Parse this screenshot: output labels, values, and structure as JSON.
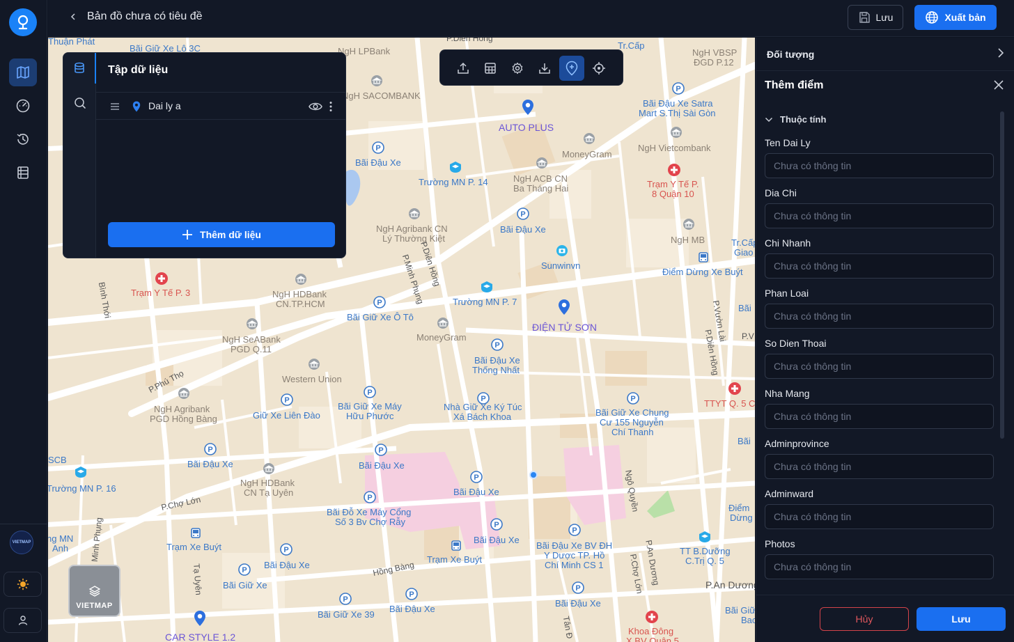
{
  "header": {
    "title": "Bản đồ chưa có tiêu đề",
    "save_label": "Lưu",
    "export_label": "Xuất bản"
  },
  "rail": {
    "brand": "VIETMAP"
  },
  "dataset": {
    "title": "Tập dữ liệu",
    "layers": [
      {
        "name": "Dai ly a"
      }
    ],
    "add_label": "Thêm dữ liệu"
  },
  "layer_switcher": {
    "label": "VIETMAP"
  },
  "map_labels": {
    "autoplus": "AUTO PLUS",
    "dientuson": "ĐIỆN TỬ SƠN",
    "carstyle": "CAR STYLE 1.2",
    "truong14": "Trường MN P. 14",
    "truong7": "Trường MN P. 7",
    "truong16": "Trường MN P. 16",
    "baidauxe": "Bãi Đậu Xe",
    "baigiuxeoto": "Bãi Giữ Xe Ô Tô",
    "moneygram": "MoneyGram",
    "westernunion": "Western Union",
    "ngh_sacombank": "NgH SACOMBANK",
    "ngh_lpbank": "NgH LPBank",
    "ngh_acb": "NgH ACB CN",
    "ngh_acb2": "Ba Tháng Hai",
    "ngh_agribank": "NgH Agribank CN",
    "ngh_agribank2": "Lý Thường Kiệt",
    "ngh_vietcombank": "NgH Vietcombank",
    "ngh_vbsp": "NgH VBSP",
    "ngh_vbsp2": "ĐGD P.12",
    "ngh_mb": "NgH MB",
    "ngh_hdbank": "NgH HDBank",
    "ngh_hdbank2": "CN.TP.HCM",
    "ngh_seabank": "NgH SeABank",
    "ngh_seabank2": "PGD Q.11",
    "ngh_agri_hb": "NgH Agribank",
    "ngh_agri_hb2": "PGD Hồng Bàng",
    "ngh_hd_tu": "NgH HDBank",
    "ngh_hd_tu2": "CN Tạ Uyên",
    "sunwinvn": "Sunwinvn",
    "tramyte8": "Trạm Y Tế P.",
    "tramyte8b": "8 Quận 10",
    "tramyte3": "Trạm Y Tế P. 3",
    "ttyt5": "TTYT Q. 5 C",
    "khoadong": "Khoa Đông",
    "diemdung": "Điểm Dừng Xe Buýt",
    "trambuyt": "Trạm Xe Buýt",
    "satra": "Bãi Đậu Xe Satra",
    "satra2": "Mart S.Thị Sài Gòn",
    "thongnhat": "Bãi Đậu Xe",
    "thongnhat2": "Thống Nhất",
    "kytuc": "Nhà Giữ Xe Ký Túc",
    "kytuc2": "Xá Bách Khoa",
    "chungcu": "Bãi Giữ Xe Chung",
    "chungcu2": "Cư 155 Nguyễn",
    "chungcu3": "Chí Thanh",
    "huuphuoc": "Bãi Giữ Xe Máy",
    "huuphuoc2": "Hữu Phước",
    "liendao": "Giữ Xe Liên Đào",
    "chorayb": "Bãi Đỗ Xe Máy Cổng",
    "chorayb2": "Số 3 Bv Chợ Rẫy",
    "bvdh": "Bãi Đậu Xe BV ĐH",
    "bvdh2": "Y Dược TP. Hồ",
    "bvdh3": "Chí Minh CS 1",
    "giuxe": "Bãi Giữ Xe",
    "giuxe39": "Bãi Giữ Xe 39",
    "ttbduong": "TT B.Dưỡng",
    "ttbduong2": "C.Trị Q. 5",
    "lo3c": "Bãi Giữ Xe Lô 3C",
    "tramcap": "Tr.Cấp",
    "diemdung2": "Điểm",
    "diemdung3": "Dừng",
    "p_dienhong": "P.Diên Hồng",
    "p_minhphung": "P.Minh Phụng",
    "p_phutho": "P.Phú Thọ",
    "p_chololon": "P.Chợ Lớn",
    "p_anduong": "P.An Dương",
    "p_vuonlai": "P.Vườn Lài",
    "hongbang": "Hồng Bàng",
    "ngoquyen": "Ngô Quyền",
    "taquyen": "Tạ Uyên",
    "minhphung2": "Minh Phụng",
    "p_chololon2": "P.Chợ Lớn",
    "p_anduong2": "P.An Dương",
    "p_dienhong2": "P.Diên Hồng",
    "binhthoi": "Bình Thới",
    "thuanphat": "Thuận Phát",
    "scb": "SCB",
    "p_v": "P.V",
    "bai": "Bãi",
    "ngmn": "ng MN",
    "anh": "Anh",
    "giao": "Tr.Cấp",
    "giao2": "Giao",
    "pdienhong_top": "P.Diên Hồng",
    "bai2": "Bãi Giữ",
    "bac": "Bac",
    "q5": "X BV Quận 5",
    "tan": "Tân Đ"
  },
  "right_panel": {
    "objects_title": "Đối tượng",
    "add_point_title": "Thêm điểm",
    "section_title": "Thuộc tính",
    "fields": [
      {
        "label": "Ten Dai Ly",
        "placeholder": "Chưa có thông tin"
      },
      {
        "label": "Dia Chi",
        "placeholder": "Chưa có thông tin"
      },
      {
        "label": "Chi Nhanh",
        "placeholder": "Chưa có thông tin"
      },
      {
        "label": "Phan Loai",
        "placeholder": "Chưa có thông tin"
      },
      {
        "label": "So Dien Thoai",
        "placeholder": "Chưa có thông tin"
      },
      {
        "label": "Nha Mang",
        "placeholder": "Chưa có thông tin"
      },
      {
        "label": "Adminprovince",
        "placeholder": "Chưa có thông tin"
      },
      {
        "label": "Adminward",
        "placeholder": "Chưa có thông tin"
      },
      {
        "label": "Photos",
        "placeholder": "Chưa có thông tin"
      }
    ],
    "cancel_label": "Hủy",
    "ok_label": "Lưu"
  },
  "colors": {
    "accent": "#1a6ff0",
    "danger": "#d4434a",
    "panel_bg": "#121826",
    "map_bg": "#efe4d0"
  }
}
